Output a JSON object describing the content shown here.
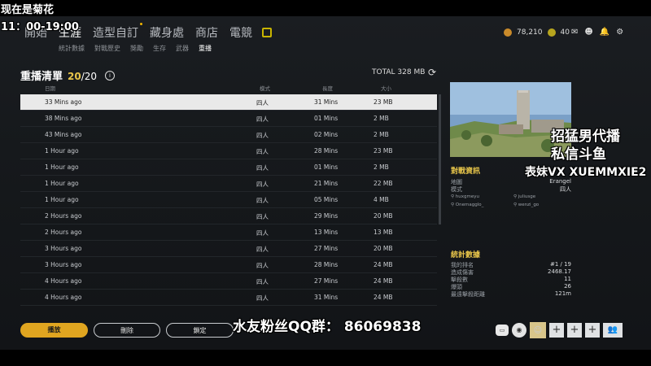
{
  "overlay": {
    "line1": "现在是菊花",
    "line2": "11：00-19:00",
    "right1": "招猛男代播",
    "right2": "私信斗鱼",
    "right3": "表妹VX XUEMMXIE2",
    "bottom": "水友粉丝QQ群：  86069838"
  },
  "nav": {
    "items": [
      "開始",
      "生涯",
      "造型自訂",
      "藏身處",
      "商店",
      "電競"
    ],
    "active": "生涯",
    "icon": "record-icon"
  },
  "subnav": {
    "items": [
      "統計數據",
      "對戰歷史",
      "獎勵",
      "生存",
      "武器",
      "重播"
    ],
    "active": "重播"
  },
  "currency": {
    "bp": "78,210",
    "gcoin": "40"
  },
  "replay": {
    "title": "重播清單",
    "count": "20",
    "count_total": "/20",
    "total": "TOTAL 328 MB",
    "headers": {
      "date": "日期",
      "mode": "模式",
      "length": "長度",
      "size": "大小"
    },
    "rows": [
      {
        "date": "33 Mins ago",
        "mode": "四人",
        "length": "31 Mins",
        "size": "23 MB"
      },
      {
        "date": "38 Mins ago",
        "mode": "四人",
        "length": "01 Mins",
        "size": "2 MB"
      },
      {
        "date": "43 Mins ago",
        "mode": "四人",
        "length": "02 Mins",
        "size": "2 MB"
      },
      {
        "date": "1 Hour ago",
        "mode": "四人",
        "length": "28 Mins",
        "size": "23 MB"
      },
      {
        "date": "1 Hour ago",
        "mode": "四人",
        "length": "01 Mins",
        "size": "2 MB"
      },
      {
        "date": "1 Hour ago",
        "mode": "四人",
        "length": "21 Mins",
        "size": "22 MB"
      },
      {
        "date": "1 Hour ago",
        "mode": "四人",
        "length": "05 Mins",
        "size": "4 MB"
      },
      {
        "date": "2 Hours ago",
        "mode": "四人",
        "length": "29 Mins",
        "size": "20 MB"
      },
      {
        "date": "2 Hours ago",
        "mode": "四人",
        "length": "13 Mins",
        "size": "13 MB"
      },
      {
        "date": "3 Hours ago",
        "mode": "四人",
        "length": "27 Mins",
        "size": "20 MB"
      },
      {
        "date": "3 Hours ago",
        "mode": "四人",
        "length": "28 Mins",
        "size": "24 MB"
      },
      {
        "date": "4 Hours ago",
        "mode": "四人",
        "length": "27 Mins",
        "size": "24 MB"
      },
      {
        "date": "4 Hours ago",
        "mode": "四人",
        "length": "31 Mins",
        "size": "24 MB"
      }
    ]
  },
  "match_info": {
    "title": "對戰資訊",
    "map_label": "地圖",
    "map_value": "Erangel",
    "mode_label": "模式",
    "mode_value": "四人",
    "players": [
      "huxgmeyu",
      "juliusge",
      "Onemagglo_",
      "wenzi_go"
    ]
  },
  "stats": {
    "title": "統計數據",
    "rows": [
      {
        "label": "我的排名",
        "value": "#1 / 19"
      },
      {
        "label": "造成傷害",
        "value": "2468.17"
      },
      {
        "label": "擊殺數",
        "value": "11"
      },
      {
        "label": "爆頭",
        "value": "26"
      },
      {
        "label": "最遠擊殺距離",
        "value": "121m"
      }
    ]
  },
  "buttons": {
    "play": "播放",
    "delete": "刪除",
    "lock": "鎖定"
  }
}
